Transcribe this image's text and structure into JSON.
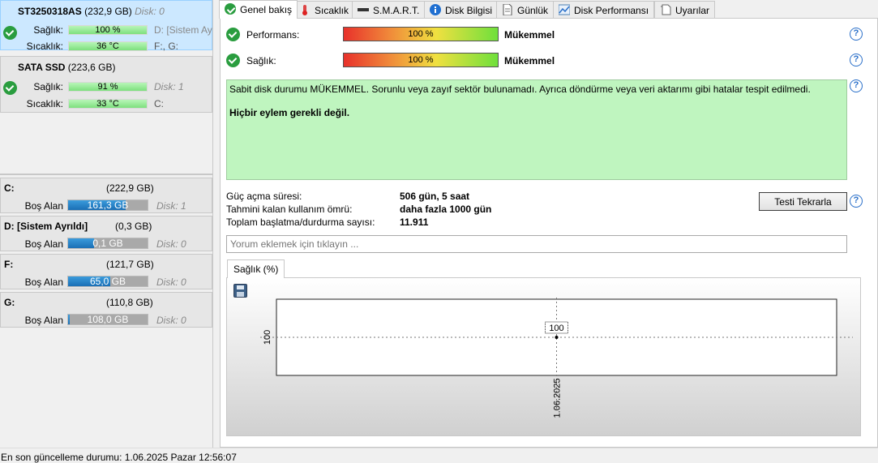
{
  "disks": [
    {
      "name": "ST3250318AS",
      "size": "(232,9 GB)",
      "index": "Disk: 0",
      "health_label": "Sağlık:",
      "health_value": "100 %",
      "health_side": "D: [Sistem Ay",
      "temp_label": "Sıcaklık:",
      "temp_value": "36 °C",
      "temp_side": "F:, G:"
    },
    {
      "name": "SATA SSD",
      "size": "(223,6 GB)",
      "health_label": "Sağlık:",
      "health_value": "91 %",
      "health_side": "Disk: 1",
      "temp_label": "Sıcaklık:",
      "temp_value": "33 °C",
      "temp_side": "C:"
    }
  ],
  "partitions": [
    {
      "name": "C:",
      "size": "(222,9 GB)",
      "free_label": "Boş Alan",
      "free_value": "161,3 GB",
      "free_fraction": 0.72,
      "disk": "Disk: 1"
    },
    {
      "name": "D: [Sistem Ayrıldı]",
      "size": "(0,3 GB)",
      "free_label": "Boş Alan",
      "free_value": "0,1 GB",
      "free_fraction": 0.33,
      "disk": "Disk: 0"
    },
    {
      "name": "F:",
      "size": "(121,7 GB)",
      "free_label": "Boş Alan",
      "free_value": "65,0 GB",
      "free_fraction": 0.53,
      "disk": "Disk: 0"
    },
    {
      "name": "G:",
      "size": "(110,8 GB)",
      "free_label": "Boş Alan",
      "free_value": "108,0 GB",
      "free_fraction": 0.02,
      "disk": "Disk: 0"
    }
  ],
  "tabs": [
    {
      "label": "Genel bakış",
      "icon": "check-icon"
    },
    {
      "label": "Sıcaklık",
      "icon": "thermometer-icon"
    },
    {
      "label": "S.M.A.R.T.",
      "icon": "drive-icon"
    },
    {
      "label": "Disk Bilgisi",
      "icon": "info-icon"
    },
    {
      "label": "Günlük",
      "icon": "document-icon"
    },
    {
      "label": "Disk Performansı",
      "icon": "chart-icon"
    },
    {
      "label": "Uyarılar",
      "icon": "alerts-icon"
    }
  ],
  "overview": {
    "performance_label": "Performans:",
    "performance_value": "100 %",
    "performance_rating": "Mükemmel",
    "health_label": "Sağlık:",
    "health_value": "100 %",
    "health_rating": "Mükemmel",
    "status_text": "Sabit disk durumu MÜKEMMEL. Sorunlu veya zayıf sektör bulunamadı. Ayrıca döndürme veya veri aktarımı gibi hatalar tespit edilmedi.",
    "action_text": "Hiçbir eylem gerekli değil.",
    "power_on_label": "Güç açma süresi:",
    "power_on_value": "506 gün, 5 saat",
    "lifetime_label": "Tahmini kalan kullanım ömrü:",
    "lifetime_value": "daha fazla 1000 gün",
    "startstop_label": "Toplam başlatma/durdurma sayısı:",
    "startstop_value": "11.911",
    "retest_button": "Testi Tekrarla",
    "comment_placeholder": "Yorum eklemek için tıklayın ..."
  },
  "chart_tab": "Sağlık (%)",
  "chart_data": {
    "type": "line",
    "series": [
      {
        "x": [
          "1.06.2025"
        ],
        "values": [
          100
        ]
      }
    ],
    "xlabel": "",
    "ylabel": "",
    "y_ticks": [
      "100"
    ],
    "x_ticks": [
      "1.06.2025"
    ],
    "point_labels": [
      "100"
    ]
  },
  "statusbar": "En son güncelleme durumu: 1.06.2025 Pazar 12:56:07",
  "colors": {
    "ok_green": "#2a9d3f",
    "status_bg": "#bff5bf",
    "help_blue": "#2a6fc9",
    "free_blue": "#1a6fb5"
  }
}
